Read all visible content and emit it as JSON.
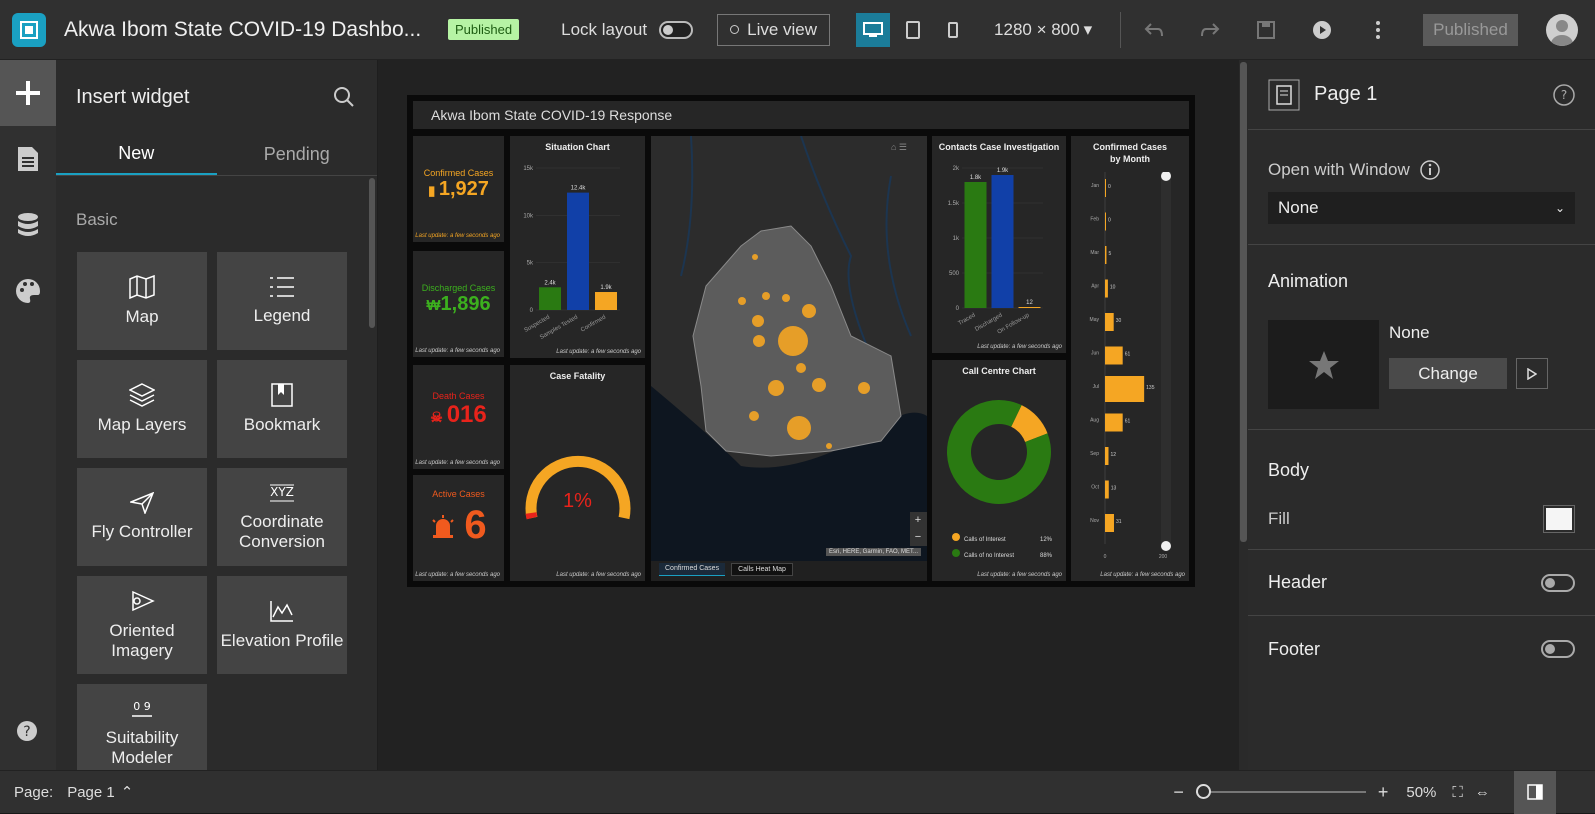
{
  "app": {
    "title": "Akwa Ibom State COVID-19 Dashbo...",
    "badge": "Published"
  },
  "toolbar": {
    "lock_label": "Lock layout",
    "live_label": "Live view",
    "resolution": "1280 × 800",
    "publish_label": "Published"
  },
  "widget_panel": {
    "title": "Insert widget",
    "tabs": [
      "New",
      "Pending"
    ],
    "section": "Basic",
    "widgets": [
      {
        "label": "Map",
        "icon": "map-icon"
      },
      {
        "label": "Legend",
        "icon": "legend-icon"
      },
      {
        "label": "Map Layers",
        "icon": "layers-icon"
      },
      {
        "label": "Bookmark",
        "icon": "bookmark-icon"
      },
      {
        "label": "Fly Controller",
        "icon": "fly-icon"
      },
      {
        "label": "Coordinate Conversion",
        "icon": "xyz-icon"
      },
      {
        "label": "Oriented Imagery",
        "icon": "oriented-imagery-icon"
      },
      {
        "label": "Elevation Profile",
        "icon": "elevation-icon"
      },
      {
        "label": "Suitability Modeler",
        "icon": "suitability-icon"
      }
    ]
  },
  "dashboard": {
    "title": "Akwa Ibom State COVID-19 Response",
    "stamp": "Last update: a few seconds ago",
    "kpis": [
      {
        "label": "Confirmed Cases",
        "value": "1,927",
        "color": "#f5a623"
      },
      {
        "label": "Discharged Cases",
        "value": "1,896",
        "color": "#3cb01e"
      },
      {
        "label": "Death Cases",
        "value": "016",
        "color": "#e8231b"
      },
      {
        "label": "Active Cases",
        "value": "6",
        "color": "#f05a1e"
      }
    ],
    "situation": {
      "title": "Situation Chart",
      "yticks": [
        "15k",
        "10k",
        "5k",
        "0"
      ],
      "bars": [
        {
          "cat": "Suspected",
          "value": 2400,
          "label": "2.4k",
          "color": "#2a7a12"
        },
        {
          "cat": "Samples Tested",
          "value": 12400,
          "label": "12.4k",
          "color": "#1140a8"
        },
        {
          "cat": "Confirmed",
          "value": 1900,
          "label": "1.9k",
          "color": "#f5a623"
        }
      ]
    },
    "fatality": {
      "title": "Case Fatality",
      "value": "1%",
      "fraction": 0.01
    },
    "map": {
      "tabs": [
        "Confirmed Cases",
        "Calls Heat Map"
      ],
      "attribution": "Esri, HERE, Garmin, FAO, MET...",
      "zoom_in": "+",
      "zoom_out": "−"
    },
    "contacts": {
      "title": "Contacts Case Investigation",
      "yticks": [
        "2k",
        "1.5k",
        "1k",
        "500",
        "0"
      ],
      "bars": [
        {
          "cat": "Traced",
          "value": 1800,
          "label": "1.8k",
          "color": "#2a7a12"
        },
        {
          "cat": "Discharged",
          "value": 1900,
          "label": "1.9k",
          "color": "#1140a8"
        },
        {
          "cat": "On Follow-up",
          "value": 12,
          "label": "12",
          "color": "#f5a623"
        }
      ]
    },
    "callcentre": {
      "title": "Call Centre Chart",
      "legend": [
        {
          "label": "Calls of Interest",
          "pct": "12%",
          "value": 12,
          "color": "#f5a623"
        },
        {
          "label": "Calls of no Interest",
          "pct": "88%",
          "value": 88,
          "color": "#2a7a12"
        }
      ]
    },
    "monthly": {
      "title_line1": "Confirmed Cases",
      "title_line2": "by Month",
      "months": [
        "Jan",
        "Feb",
        "Mar",
        "Apr",
        "May",
        "Jun",
        "Jul",
        "Aug",
        "Sep",
        "Oct",
        "Nov"
      ],
      "values": [
        0,
        0,
        5,
        10,
        30,
        61,
        135,
        61,
        12,
        13,
        31
      ],
      "xticks": [
        "0",
        "200"
      ]
    }
  },
  "right_panel": {
    "page_title": "Page 1",
    "open_with_label": "Open with Window",
    "open_with_value": "None",
    "animation_label": "Animation",
    "animation_value": "None",
    "change_label": "Change",
    "body_label": "Body",
    "fill_label": "Fill",
    "header_label": "Header",
    "footer_label": "Footer"
  },
  "status": {
    "page_label": "Page:",
    "page_value": "Page 1",
    "zoom": "50%"
  }
}
